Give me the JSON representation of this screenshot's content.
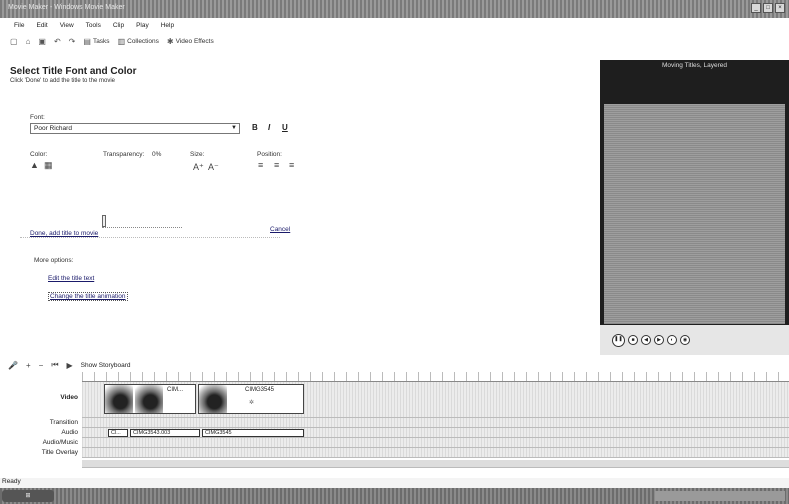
{
  "window": {
    "title": "Movie Maker - Windows Movie Maker"
  },
  "menu": [
    "File",
    "Edit",
    "View",
    "Tools",
    "Clip",
    "Play",
    "Help"
  ],
  "toolbar": {
    "tasks": "Tasks",
    "collections": "Collections",
    "video_effects": "Video Effects"
  },
  "panel": {
    "title": "Select Title Font and Color",
    "subtitle": "Click 'Done' to add the title to the movie",
    "font_label": "Font:",
    "font_value": "Poor Richard",
    "color_label": "Color:",
    "transparency_label": "Transparency:",
    "transparency_value": "0%",
    "size_label": "Size:",
    "position_label": "Position:",
    "done_link": "Done, add title to movie",
    "cancel_link": "Cancel",
    "more_options": "More options:",
    "edit_text_link": "Edit the title text",
    "change_animation_link": "Change the title animation"
  },
  "preview": {
    "title": "Moving Titles, Layered"
  },
  "timeline": {
    "show_storyboard": "Show Storyboard",
    "tracks": [
      "Video",
      "Transition",
      "Audio",
      "Audio/Music",
      "Title Overlay"
    ],
    "video_clips": [
      "CIM...",
      "CIMG3545"
    ],
    "audio_clips": [
      "Cl...",
      "CIMG3543.003",
      "CIMG3545"
    ]
  },
  "status": "Ready"
}
